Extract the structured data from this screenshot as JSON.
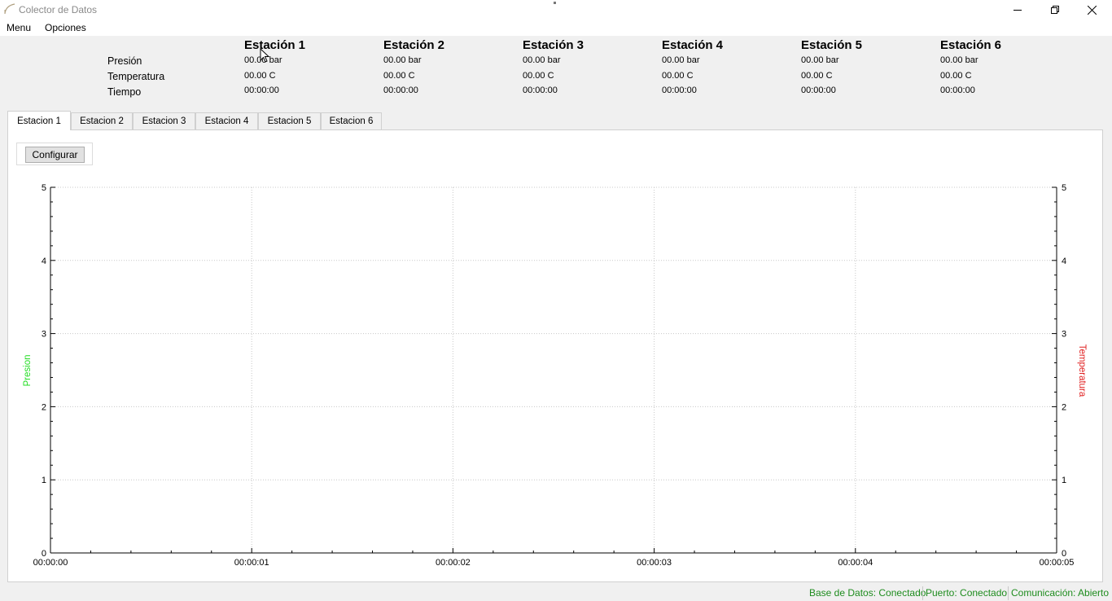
{
  "window": {
    "title": "Colector de Datos"
  },
  "menu": {
    "items": [
      "Menu",
      "Opciones"
    ]
  },
  "stations": {
    "row_labels": [
      "Presión",
      "Temperatura",
      "Tiempo"
    ],
    "list": [
      {
        "name": "Estación 1",
        "pressure": "00.00 bar",
        "temperature": "00.00 C",
        "time": "00:00:00"
      },
      {
        "name": "Estación 2",
        "pressure": "00.00 bar",
        "temperature": "00.00 C",
        "time": "00:00:00"
      },
      {
        "name": "Estación 3",
        "pressure": "00.00 bar",
        "temperature": "00.00 C",
        "time": "00:00:00"
      },
      {
        "name": "Estación 4",
        "pressure": "00.00 bar",
        "temperature": "00.00 C",
        "time": "00:00:00"
      },
      {
        "name": "Estación 5",
        "pressure": "00.00 bar",
        "temperature": "00.00 C",
        "time": "00:00:00"
      },
      {
        "name": "Estación 6",
        "pressure": "00.00 bar",
        "temperature": "00.00 C",
        "time": "00:00:00"
      }
    ]
  },
  "tabs": [
    "Estacion 1",
    "Estacion 2",
    "Estacion 3",
    "Estacion 4",
    "Estacion 5",
    "Estacion 6"
  ],
  "active_tab": "Estacion 1",
  "config_button_label": "Configurar",
  "chart_data": {
    "type": "line",
    "x_tick_labels": [
      "00:00:00",
      "00:00:01",
      "00:00:02",
      "00:00:03",
      "00:00:04",
      "00:00:05"
    ],
    "xlim": [
      "00:00:00",
      "00:00:05"
    ],
    "y_left_label": "Presion",
    "y_right_label": "Temperatura",
    "ylim_left": [
      0,
      5
    ],
    "ylim_right": [
      0,
      5
    ],
    "y_ticks": [
      0,
      1,
      2,
      3,
      4,
      5
    ],
    "grid": true,
    "series": [],
    "colors": {
      "left_axis_title": "#22dd22",
      "right_axis_title": "#e02020",
      "grid": "#c8c8c8"
    }
  },
  "status": [
    "Base de Datos: Conectado",
    "Puerto: Conectado",
    "Comunicación: Abierto"
  ],
  "status_color": "#1e8c1e"
}
